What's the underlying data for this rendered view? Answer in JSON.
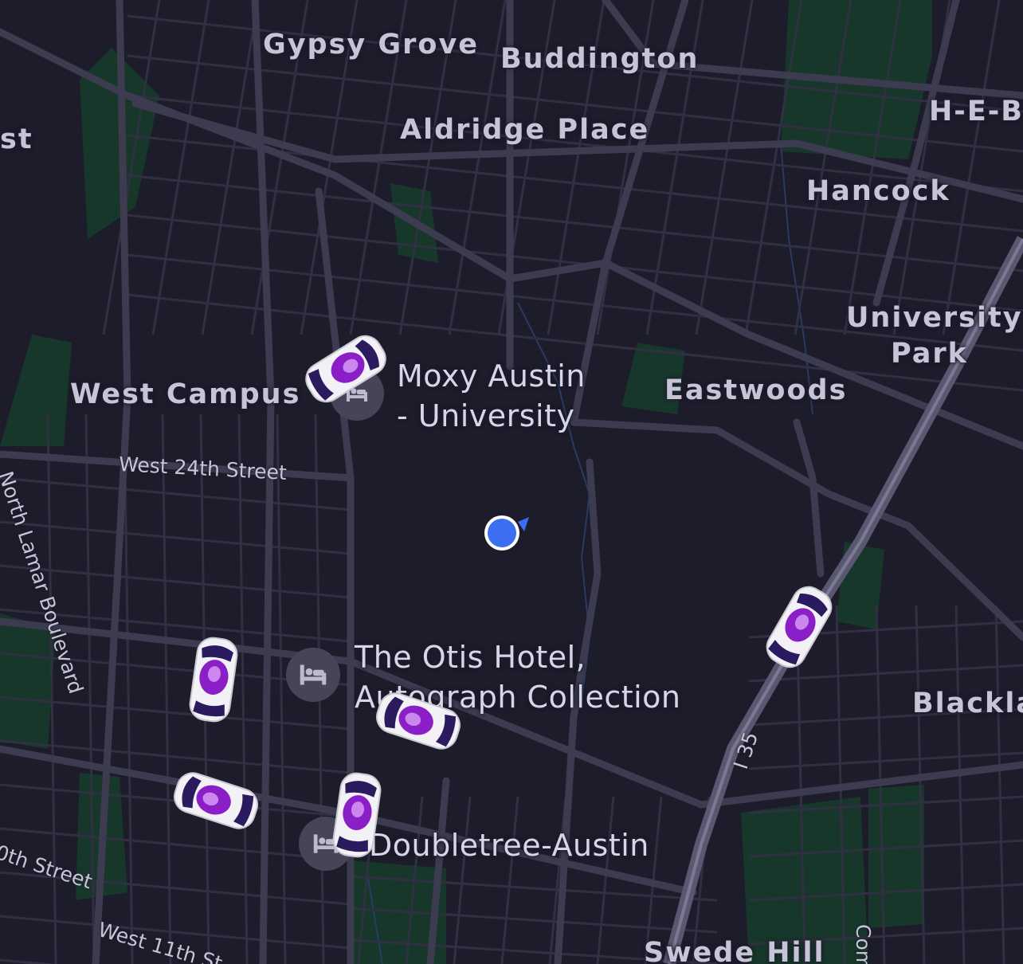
{
  "map": {
    "colors": {
      "background": "#1d1c2b",
      "road": "#3a384b",
      "highway": "#5a5870",
      "park": "#17372b",
      "label": "#c7c4d6",
      "car_accent": "#8a1fc7",
      "user_dot": "#3b6ef2"
    },
    "neighborhoods": {
      "gypsy_grove": "Gypsy Grove",
      "buddington": "Buddington",
      "aldridge_place": "Aldridge Place",
      "heb": "H-E-B",
      "hancock": "Hancock",
      "west_campus": "West Campus",
      "university_park_1": "University",
      "university_park_2": "Park",
      "eastwoods": "Eastwoods",
      "blackland": "Blackla",
      "swede_hill": "Swede Hill",
      "partial_west": "st"
    },
    "streets": {
      "w24": "West 24th Street",
      "lamar": "North Lamar Boulevard",
      "w10": "0th Street",
      "w11": "West 11th St",
      "i35": "I 35",
      "com": "Com"
    },
    "pois": [
      {
        "name_line1": "Moxy Austin",
        "name_line2": "- University",
        "icon": "hotel-icon"
      },
      {
        "name_line1": "The Otis Hotel,",
        "name_line2": "Autograph Collection",
        "icon": "hotel-icon"
      },
      {
        "name_line1": "Doubletree-Austin",
        "name_line2": "",
        "icon": "hotel-icon"
      }
    ],
    "vehicles_count": 6,
    "user_location_icon": "location-dot-icon"
  }
}
